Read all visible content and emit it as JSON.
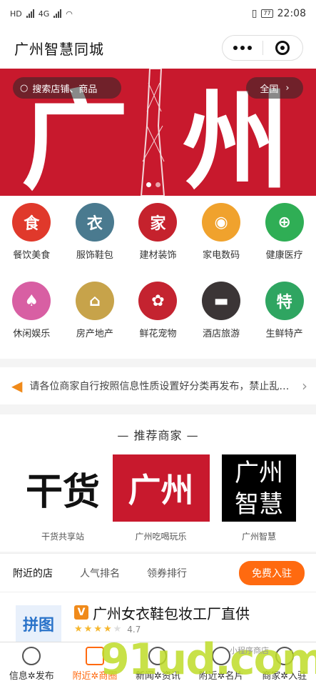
{
  "status": {
    "time": "22:08",
    "battery": "77",
    "net_left": "HD",
    "net_mid": "4G"
  },
  "header": {
    "title": "广州智慧同城"
  },
  "banner": {
    "search_placeholder": "搜索店铺、商品",
    "region": "全国",
    "bg_text": "广州"
  },
  "categories": [
    {
      "label": "餐饮美食",
      "icon": "food-icon",
      "color": "#e0392b",
      "glyph": "食"
    },
    {
      "label": "服饰鞋包",
      "icon": "shirt-icon",
      "color": "#4a7a8f",
      "glyph": "衣"
    },
    {
      "label": "建材装饰",
      "icon": "house-icon",
      "color": "#c5222d",
      "glyph": "家"
    },
    {
      "label": "家电数码",
      "icon": "camera-icon",
      "color": "#f0a22d",
      "glyph": "◉"
    },
    {
      "label": "健康医疗",
      "icon": "medical-icon",
      "color": "#2fae55",
      "glyph": "⊕"
    },
    {
      "label": "休闲娱乐",
      "icon": "card-icon",
      "color": "#d85fa3",
      "glyph": "♠"
    },
    {
      "label": "房产地产",
      "icon": "building-icon",
      "color": "#c7a34a",
      "glyph": "⌂"
    },
    {
      "label": "鲜花宠物",
      "icon": "flower-icon",
      "color": "#c42330",
      "glyph": "✿"
    },
    {
      "label": "酒店旅游",
      "icon": "bed-icon",
      "color": "#3b3536",
      "glyph": "▬"
    },
    {
      "label": "生鲜特产",
      "icon": "leaf-icon",
      "color": "#2fa561",
      "glyph": "特"
    }
  ],
  "notice": {
    "text": "请各位商家自行按照信息性质设置好分类再发布，禁止乱发布"
  },
  "recommend": {
    "title": "— 推荐商家 —",
    "items": [
      {
        "caption": "干货共享站",
        "art": "干货"
      },
      {
        "caption": "广州吃喝玩乐",
        "art": "广州"
      },
      {
        "caption": "广州智慧",
        "art": "广州智慧"
      }
    ]
  },
  "tabs": {
    "items": [
      "附近的店",
      "人气排名",
      "领券排行"
    ],
    "join": "免费入驻"
  },
  "shop": {
    "badge": "V",
    "name": "广州女衣鞋包妆工厂直供",
    "rating": "4.7",
    "thumb": "拼图"
  },
  "bottom_nav": [
    {
      "label": "信息✲发布",
      "icon": "info-icon"
    },
    {
      "label": "附近✲商圈",
      "icon": "home-icon"
    },
    {
      "label": "新闻✲资讯",
      "icon": "news-icon"
    },
    {
      "label": "附近✲名片",
      "icon": "card-icon"
    },
    {
      "label": "商家✲入驻",
      "icon": "store-icon"
    }
  ],
  "watermark": {
    "text": "91ud.com",
    "small": "小程序商店"
  }
}
